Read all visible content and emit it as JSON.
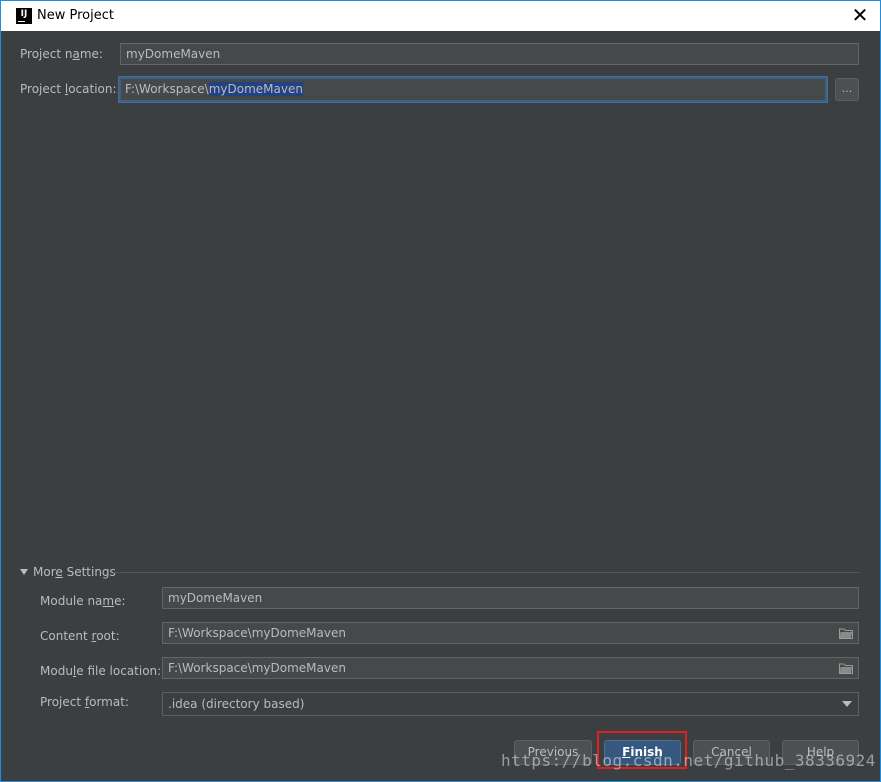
{
  "window": {
    "title": "New Project",
    "close_glyph": "✕"
  },
  "app_icon": {
    "glyph": "IJ"
  },
  "project_name": {
    "label_pre": "Project n",
    "label_mnemonic": "a",
    "label_post": "me:",
    "value": "myDomeMaven"
  },
  "project_location": {
    "label_pre": "Project ",
    "label_mnemonic": "l",
    "label_post": "ocation:",
    "value_prefix": "F:\\Workspace\\",
    "value_selected": "myDomeMaven",
    "browse_label": "..."
  },
  "more_settings": {
    "label_pre": "Mor",
    "label_mnemonic": "e",
    "label_post": " Settings",
    "module_name": {
      "label_pre": "Module na",
      "label_mnemonic": "m",
      "label_post": "e:",
      "value": "myDomeMaven"
    },
    "content_root": {
      "label_pre": "Content ",
      "label_mnemonic": "r",
      "label_post": "oot:",
      "value": "F:\\Workspace\\myDomeMaven"
    },
    "module_file_location": {
      "label_pre": "Modu",
      "label_mnemonic": "l",
      "label_post": "e file location:",
      "value": "F:\\Workspace\\myDomeMaven"
    },
    "project_format": {
      "label_pre": "Project ",
      "label_mnemonic": "f",
      "label_post": "ormat:",
      "value": ".idea (directory based)"
    }
  },
  "buttons": {
    "previous": "Previous",
    "finish_mnemonic": "F",
    "finish_rest": "inish",
    "cancel": "Cancel",
    "help": "Help"
  },
  "watermark": "https://blog.csdn.net/github_38336924",
  "colors": {
    "background": "#3c3f41",
    "field_bg": "#45494a",
    "selection": "#214283",
    "default_button": "#365880",
    "highlight_box": "#e02020",
    "window_border": "#1f8ee0"
  }
}
